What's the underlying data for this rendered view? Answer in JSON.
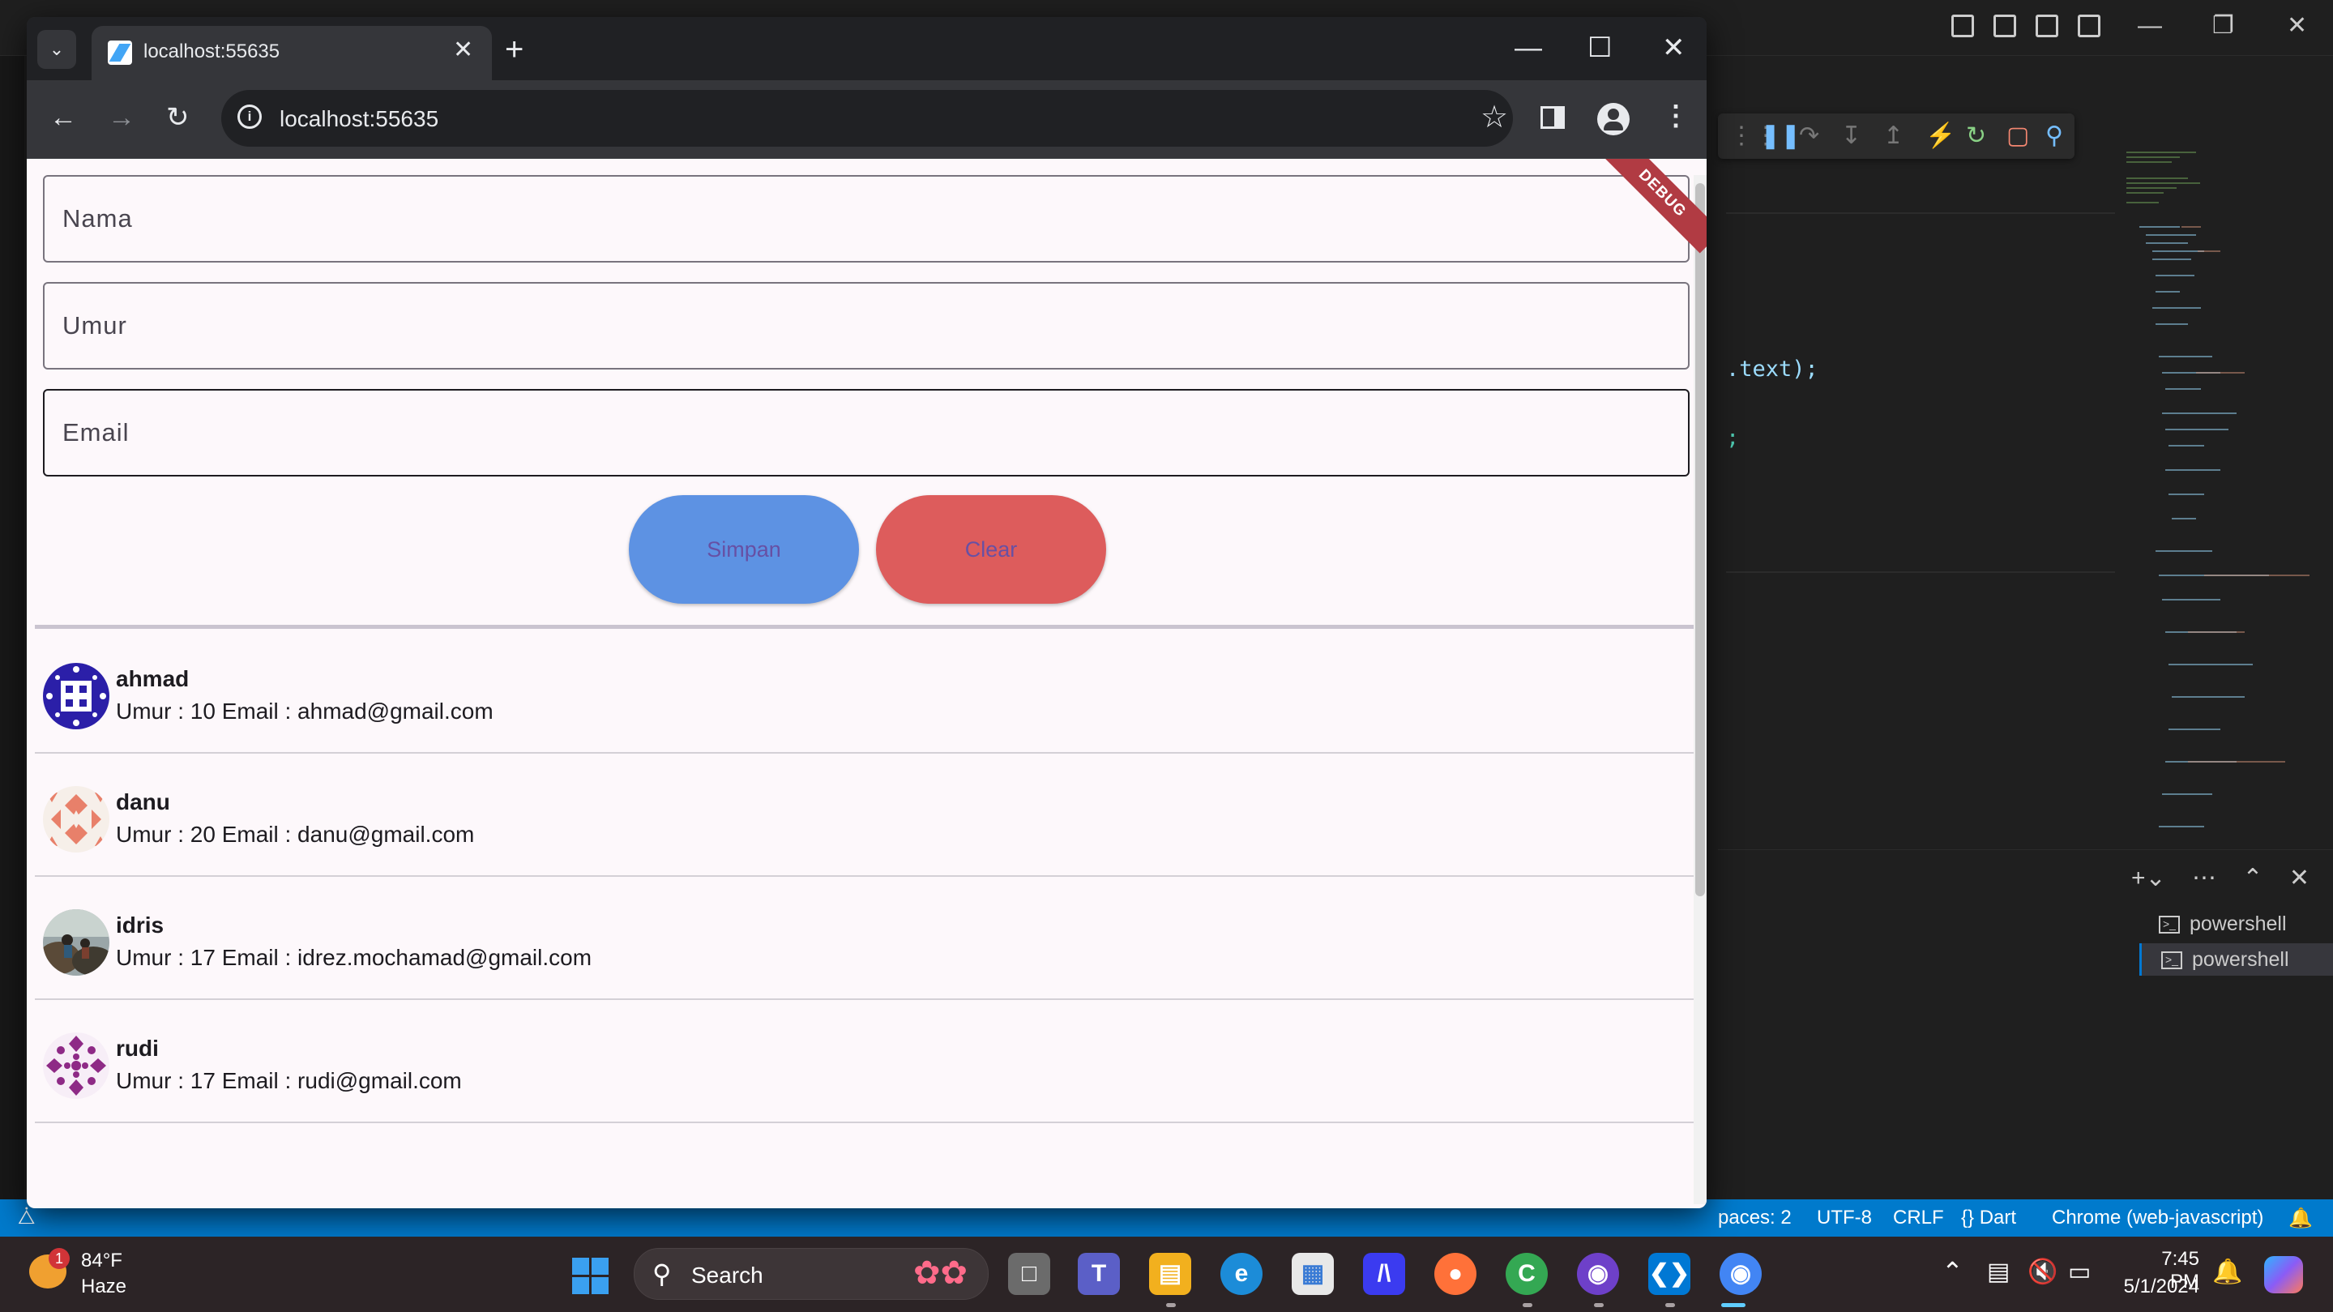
{
  "vscode": {
    "code_fragment_1": ".text);",
    "code_fragment_2": ";",
    "terminals": [
      "powershell",
      "powershell"
    ],
    "status_bar": {
      "spaces": "paces: 2",
      "encoding": "UTF-8",
      "eol": "CRLF",
      "language": "{} Dart",
      "device": "Chrome (web-javascript)"
    }
  },
  "browser": {
    "tab_title": "localhost:55635",
    "url": "localhost:55635"
  },
  "form": {
    "nama_placeholder": "Nama",
    "umur_placeholder": "Umur",
    "email_placeholder": "Email",
    "simpan_label": "Simpan",
    "clear_label": "Clear",
    "debug_banner": "DEBUG",
    "colors": {
      "simpan": "#5d92e3",
      "clear": "#dd5c5c",
      "label": "#6750a4"
    }
  },
  "users": [
    {
      "name": "ahmad",
      "detail": "Umur : 10 Email : ahmad@gmail.com"
    },
    {
      "name": "danu",
      "detail": "Umur : 20 Email : danu@gmail.com"
    },
    {
      "name": "idris",
      "detail": "Umur : 17 Email : idrez.mochamad@gmail.com"
    },
    {
      "name": "rudi",
      "detail": "Umur : 17 Email : rudi@gmail.com"
    }
  ],
  "taskbar": {
    "weather_temp": "84°F",
    "weather_condition": "Haze",
    "weather_badge": "1",
    "search_label": "Search",
    "time": "7:45 PM",
    "date": "5/1/2024"
  }
}
